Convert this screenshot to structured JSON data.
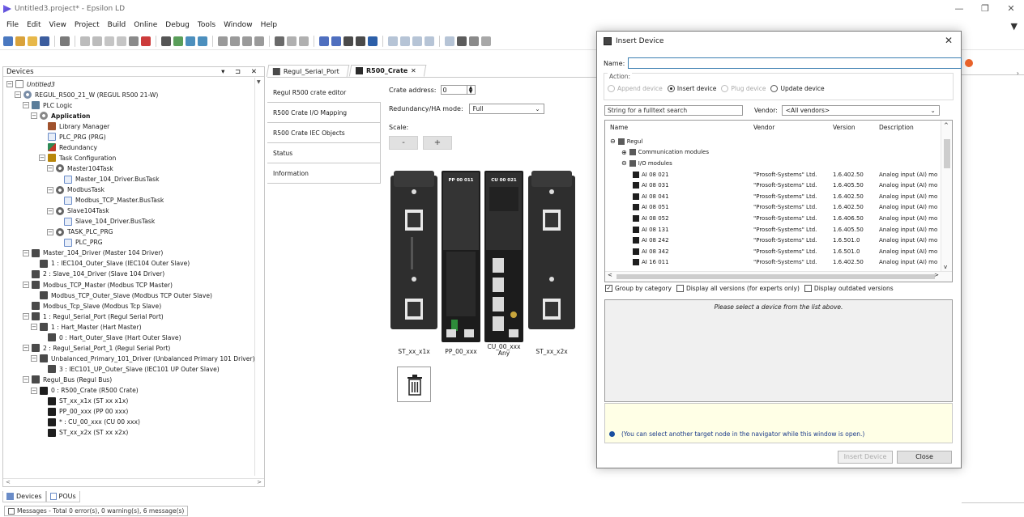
{
  "window": {
    "title": "Untitled3.project* - Epsilon LD",
    "controls": [
      "—",
      "❐",
      "✕"
    ]
  },
  "menu": [
    "File",
    "Edit",
    "View",
    "Project",
    "Build",
    "Online",
    "Debug",
    "Tools",
    "Window",
    "Help"
  ],
  "devices_pane": {
    "title": "Devices",
    "header_controls": "▾ ⊐ ✕",
    "tree": [
      {
        "label": "Untitled3",
        "level": 0,
        "icon": "project-icon",
        "italic": true
      },
      {
        "label": "REGUL_R500_21_W (REGUL R500 21-W)",
        "level": 1,
        "icon": "plc-device-icon"
      },
      {
        "label": "PLC Logic",
        "level": 2,
        "icon": "plc-logic-icon"
      },
      {
        "label": "Application",
        "level": 3,
        "icon": "application-icon",
        "bold": true
      },
      {
        "label": "Library Manager",
        "level": 4,
        "icon": "library-manager-icon"
      },
      {
        "label": "PLC_PRG (PRG)",
        "level": 4,
        "icon": "program-icon"
      },
      {
        "label": "Redundancy",
        "level": 4,
        "icon": "redundancy-icon"
      },
      {
        "label": "Task Configuration",
        "level": 4,
        "icon": "task-configuration-icon"
      },
      {
        "label": "Master104Task",
        "level": 5,
        "icon": "task-icon"
      },
      {
        "label": "Master_104_Driver.BusTask",
        "level": 6,
        "icon": "program-icon"
      },
      {
        "label": "ModbusTask",
        "level": 5,
        "icon": "task-icon"
      },
      {
        "label": "Modbus_TCP_Master.BusTask",
        "level": 6,
        "icon": "program-icon"
      },
      {
        "label": "Slave104Task",
        "level": 5,
        "icon": "task-icon"
      },
      {
        "label": "Slave_104_Driver.BusTask",
        "level": 6,
        "icon": "program-icon"
      },
      {
        "label": "TASK_PLC_PRG",
        "level": 5,
        "icon": "task-icon"
      },
      {
        "label": "PLC_PRG",
        "level": 6,
        "icon": "program-icon"
      },
      {
        "label": "Master_104_Driver (Master 104 Driver)",
        "level": 2,
        "icon": "device-icon"
      },
      {
        "label": "1 : IEC104_Outer_Slave (IEC104 Outer Slave)",
        "level": 3,
        "icon": "device-icon"
      },
      {
        "label": "2 : Slave_104_Driver (Slave 104 Driver)",
        "level": 2,
        "icon": "device-icon"
      },
      {
        "label": "Modbus_TCP_Master (Modbus TCP Master)",
        "level": 2,
        "icon": "device-icon"
      },
      {
        "label": "Modbus_TCP_Outer_Slave (Modbus TCP Outer Slave)",
        "level": 3,
        "icon": "device-icon"
      },
      {
        "label": "Modbus_Tcp_Slave (Modbus Tcp Slave)",
        "level": 2,
        "icon": "device-icon"
      },
      {
        "label": "1 : Regul_Serial_Port (Regul Serial Port)",
        "level": 2,
        "icon": "device-icon"
      },
      {
        "label": "1 : Hart_Master (Hart Master)",
        "level": 3,
        "icon": "device-icon"
      },
      {
        "label": "0 : Hart_Outer_Slave (Hart Outer Slave)",
        "level": 4,
        "icon": "device-icon"
      },
      {
        "label": "2 : Regul_Serial_Port_1 (Regul Serial Port)",
        "level": 2,
        "icon": "device-icon"
      },
      {
        "label": "Unbalanced_Primary_101_Driver (Unbalanced Primary 101 Driver)",
        "level": 3,
        "icon": "device-icon"
      },
      {
        "label": "3 : IEC101_UP_Outer_Slave (IEC101 UP Outer Slave)",
        "level": 4,
        "icon": "device-icon"
      },
      {
        "label": "Regul_Bus (Regul Bus)",
        "level": 2,
        "icon": "device-icon"
      },
      {
        "label": "0 : R500_Crate (R500 Crate)",
        "level": 3,
        "icon": "crate-icon"
      },
      {
        "label": "ST_xx_x1x (ST xx x1x)",
        "level": 4,
        "icon": "module-icon"
      },
      {
        "label": "PP_00_xxx (PP 00 xxx)",
        "level": 4,
        "icon": "module-icon"
      },
      {
        "label": "* : CU_00_xxx (CU 00 xxx)",
        "level": 4,
        "icon": "module-icon"
      },
      {
        "label": "ST_xx_x2x (ST xx x2x)",
        "level": 4,
        "icon": "module-icon"
      }
    ]
  },
  "bottom_tabs": [
    "Devices",
    "POUs"
  ],
  "status": "Messages - Total 0 error(s), 0 warning(s), 6 message(s)",
  "editor": {
    "tabs": [
      {
        "label": "Regul_Serial_Port",
        "active": false
      },
      {
        "label": "R500_Crate",
        "active": true,
        "close": "✕"
      }
    ],
    "nav": [
      {
        "label": "Regul R500 crate editor",
        "active": true
      },
      {
        "label": "R500 Crate I/O Mapping",
        "active": false
      },
      {
        "label": "R500 Crate IEC Objects",
        "active": false
      },
      {
        "label": "Status",
        "active": false
      },
      {
        "label": "Information",
        "active": false
      }
    ],
    "crate_address_label": "Crate address:",
    "crate_address_value": "0",
    "redundancy_label": "Redundancy/HA mode:",
    "redundancy_value": "Full",
    "scale_label": "Scale:",
    "scale_minus": "-",
    "scale_plus": "+",
    "modules": [
      {
        "label": "ST_xx_x1x",
        "badge": ""
      },
      {
        "label": "PP_00_xxx",
        "badge": "PP 00 011"
      },
      {
        "label": "CU_00_xxx\nAny",
        "badge": "CU 00 021"
      },
      {
        "label": "ST_xx_x2x",
        "badge": ""
      }
    ]
  },
  "dialog": {
    "title": "Insert Device",
    "close": "✕",
    "name_label": "Name:",
    "name_value": "",
    "action_label": "Action:",
    "actions": [
      {
        "label": "Append device",
        "selected": false,
        "disabled": true
      },
      {
        "label": "Insert device",
        "selected": true,
        "disabled": false
      },
      {
        "label": "Plug device",
        "selected": false,
        "disabled": true
      },
      {
        "label": "Update device",
        "selected": false,
        "disabled": false
      }
    ],
    "search_placeholder": "String for a fulltext search",
    "vendor_label": "Vendor:",
    "vendor_value": "<All vendors>",
    "columns": [
      "Name",
      "Vendor",
      "Version",
      "Description"
    ],
    "rows": [
      {
        "name": "Regul",
        "vendor": "",
        "version": "",
        "description": "",
        "level": 0,
        "exp": "⊟"
      },
      {
        "name": "Communication modules",
        "vendor": "",
        "version": "",
        "description": "",
        "level": 1,
        "exp": "⊞"
      },
      {
        "name": "I/O modules",
        "vendor": "",
        "version": "",
        "description": "",
        "level": 1,
        "exp": "⊟"
      },
      {
        "name": "AI 08 021",
        "vendor": "\"Prosoft-Systems\" Ltd.",
        "version": "1.6.402.50",
        "description": "Analog input (AI) mod",
        "level": 2
      },
      {
        "name": "AI 08 031",
        "vendor": "\"Prosoft-Systems\" Ltd.",
        "version": "1.6.405.50",
        "description": "Analog input (AI) mod",
        "level": 2
      },
      {
        "name": "AI 08 041",
        "vendor": "\"Prosoft-Systems\" Ltd.",
        "version": "1.6.402.50",
        "description": "Analog input (AI) mod",
        "level": 2
      },
      {
        "name": "AI 08 051",
        "vendor": "\"Prosoft-Systems\" Ltd.",
        "version": "1.6.402.50",
        "description": "Analog input (AI) mod",
        "level": 2
      },
      {
        "name": "AI 08 052",
        "vendor": "\"Prosoft-Systems\" Ltd.",
        "version": "1.6.406.50",
        "description": "Analog input (AI) mod",
        "level": 2
      },
      {
        "name": "AI 08 131",
        "vendor": "\"Prosoft-Systems\" Ltd.",
        "version": "1.6.405.50",
        "description": "Analog input (AI) mod",
        "level": 2
      },
      {
        "name": "AI 08 242",
        "vendor": "\"Prosoft-Systems\" Ltd.",
        "version": "1.6.501.0",
        "description": "Analog input (AI) mod",
        "level": 2
      },
      {
        "name": "AI 08 342",
        "vendor": "\"Prosoft-Systems\" Ltd.",
        "version": "1.6.501.0",
        "description": "Analog input (AI) mod",
        "level": 2
      },
      {
        "name": "AI 16 011",
        "vendor": "\"Prosoft-Systems\" Ltd.",
        "version": "1.6.402.50",
        "description": "Analog input (AI) mod",
        "level": 2
      }
    ],
    "checks": [
      {
        "label": "Group by category",
        "checked": true
      },
      {
        "label": "Display all versions (for experts only)",
        "checked": false
      },
      {
        "label": "Display outdated versions",
        "checked": false
      }
    ],
    "description_placeholder": "Please select a device from the list above.",
    "info_text": "(You can select another target node in the navigator while this window is open.)",
    "insert_button": "Insert Device",
    "close_button": "Close"
  },
  "colors": {
    "accent": "#3c7fb1",
    "info_bg": "#ffffe6",
    "error": "#e8622a"
  }
}
